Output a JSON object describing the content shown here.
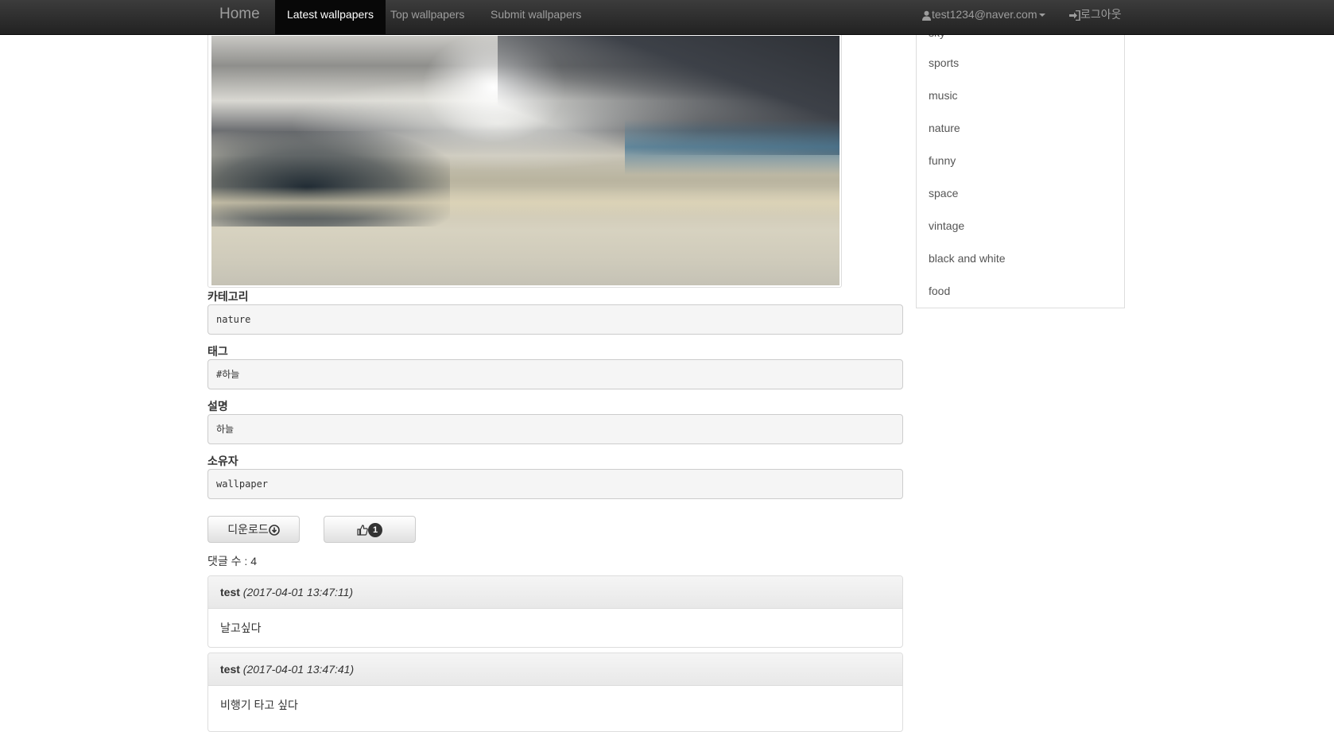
{
  "navbar": {
    "brand": "Home",
    "items": [
      {
        "label": "Latest wallpapers"
      },
      {
        "label": "Top wallpapers"
      },
      {
        "label": "Submit wallpapers"
      }
    ],
    "user_email": "test1234@naver.com",
    "logout_label": "로그아웃"
  },
  "wallpaper": {
    "image_icon": "sky-clouds-photo"
  },
  "fields": [
    {
      "label": "카테고리",
      "value": "nature"
    },
    {
      "label": "태그",
      "value": "#하늘"
    },
    {
      "label": "설명",
      "value": "하늘"
    },
    {
      "label": "소유자",
      "value": "wallpaper"
    }
  ],
  "actions": {
    "download_label": "디운로드",
    "download_icon": "circle-arrow-down-icon",
    "like_icon": "thumbs-up-icon",
    "like_count": "1"
  },
  "comments": {
    "count_label": "댓글 수 : 4",
    "items": [
      {
        "author": "test",
        "time": "(2017-04-01 13:47:11)",
        "text": "날고싶다"
      },
      {
        "author": "test",
        "time": "(2017-04-01 13:47:41)",
        "text": "비행기 타고 싶다"
      }
    ]
  },
  "sidebar": {
    "categories": [
      "sky",
      "sports",
      "music",
      "nature",
      "funny",
      "space",
      "vintage",
      "black and white",
      "food"
    ]
  }
}
